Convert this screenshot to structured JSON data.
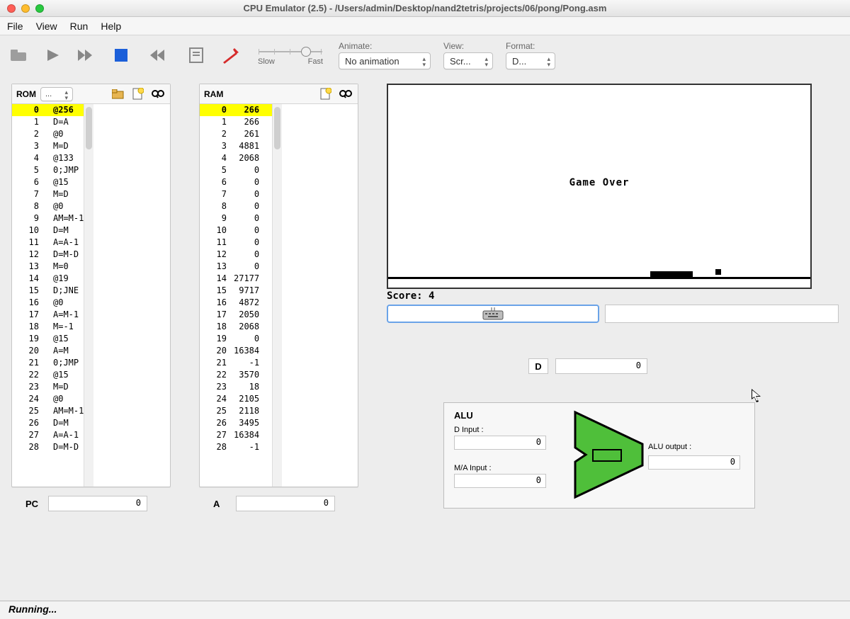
{
  "window": {
    "title": "CPU Emulator (2.5) - /Users/admin/Desktop/nand2tetris/projects/06/pong/Pong.asm"
  },
  "menu": [
    "File",
    "View",
    "Run",
    "Help"
  ],
  "controls": {
    "slider": {
      "slow": "Slow",
      "fast": "Fast"
    },
    "animate": {
      "label": "Animate:",
      "value": "No animation"
    },
    "view": {
      "label": "View:",
      "value": "Scr..."
    },
    "format": {
      "label": "Format:",
      "value": "D..."
    }
  },
  "rom": {
    "title": "ROM",
    "selector": "...",
    "rows": [
      {
        "addr": 0,
        "val": "@256"
      },
      {
        "addr": 1,
        "val": "D=A"
      },
      {
        "addr": 2,
        "val": "@0"
      },
      {
        "addr": 3,
        "val": "M=D"
      },
      {
        "addr": 4,
        "val": "@133"
      },
      {
        "addr": 5,
        "val": "0;JMP"
      },
      {
        "addr": 6,
        "val": "@15"
      },
      {
        "addr": 7,
        "val": "M=D"
      },
      {
        "addr": 8,
        "val": "@0"
      },
      {
        "addr": 9,
        "val": "AM=M-1"
      },
      {
        "addr": 10,
        "val": "D=M"
      },
      {
        "addr": 11,
        "val": "A=A-1"
      },
      {
        "addr": 12,
        "val": "D=M-D"
      },
      {
        "addr": 13,
        "val": "M=0"
      },
      {
        "addr": 14,
        "val": "@19"
      },
      {
        "addr": 15,
        "val": "D;JNE"
      },
      {
        "addr": 16,
        "val": "@0"
      },
      {
        "addr": 17,
        "val": "A=M-1"
      },
      {
        "addr": 18,
        "val": "M=-1"
      },
      {
        "addr": 19,
        "val": "@15"
      },
      {
        "addr": 20,
        "val": "A=M"
      },
      {
        "addr": 21,
        "val": "0;JMP"
      },
      {
        "addr": 22,
        "val": "@15"
      },
      {
        "addr": 23,
        "val": "M=D"
      },
      {
        "addr": 24,
        "val": "@0"
      },
      {
        "addr": 25,
        "val": "AM=M-1"
      },
      {
        "addr": 26,
        "val": "D=M"
      },
      {
        "addr": 27,
        "val": "A=A-1"
      },
      {
        "addr": 28,
        "val": "D=M-D"
      }
    ]
  },
  "ram": {
    "title": "RAM",
    "rows": [
      {
        "addr": 0,
        "val": 266
      },
      {
        "addr": 1,
        "val": 266
      },
      {
        "addr": 2,
        "val": 261
      },
      {
        "addr": 3,
        "val": 4881
      },
      {
        "addr": 4,
        "val": 2068
      },
      {
        "addr": 5,
        "val": 0
      },
      {
        "addr": 6,
        "val": 0
      },
      {
        "addr": 7,
        "val": 0
      },
      {
        "addr": 8,
        "val": 0
      },
      {
        "addr": 9,
        "val": 0
      },
      {
        "addr": 10,
        "val": 0
      },
      {
        "addr": 11,
        "val": 0
      },
      {
        "addr": 12,
        "val": 0
      },
      {
        "addr": 13,
        "val": 0
      },
      {
        "addr": 14,
        "val": 27177
      },
      {
        "addr": 15,
        "val": 9717
      },
      {
        "addr": 16,
        "val": 4872
      },
      {
        "addr": 17,
        "val": 2050
      },
      {
        "addr": 18,
        "val": 2068
      },
      {
        "addr": 19,
        "val": 0
      },
      {
        "addr": 20,
        "val": 16384
      },
      {
        "addr": 21,
        "val": -1
      },
      {
        "addr": 22,
        "val": 3570
      },
      {
        "addr": 23,
        "val": 18
      },
      {
        "addr": 24,
        "val": 2105
      },
      {
        "addr": 25,
        "val": 2118
      },
      {
        "addr": 26,
        "val": 3495
      },
      {
        "addr": 27,
        "val": 16384
      },
      {
        "addr": 28,
        "val": -1
      }
    ]
  },
  "registers": {
    "pcLabel": "PC",
    "pc": 0,
    "aLabel": "A",
    "a": 0,
    "dLabel": "D",
    "d": 0
  },
  "screen": {
    "gameover": "Game Over",
    "score": "Score: 4"
  },
  "alu": {
    "title": "ALU",
    "dInputLabel": "D Input :",
    "dInput": 0,
    "maInputLabel": "M/A Input :",
    "maInput": 0,
    "outputLabel": "ALU output :",
    "output": 0
  },
  "status": "Running..."
}
